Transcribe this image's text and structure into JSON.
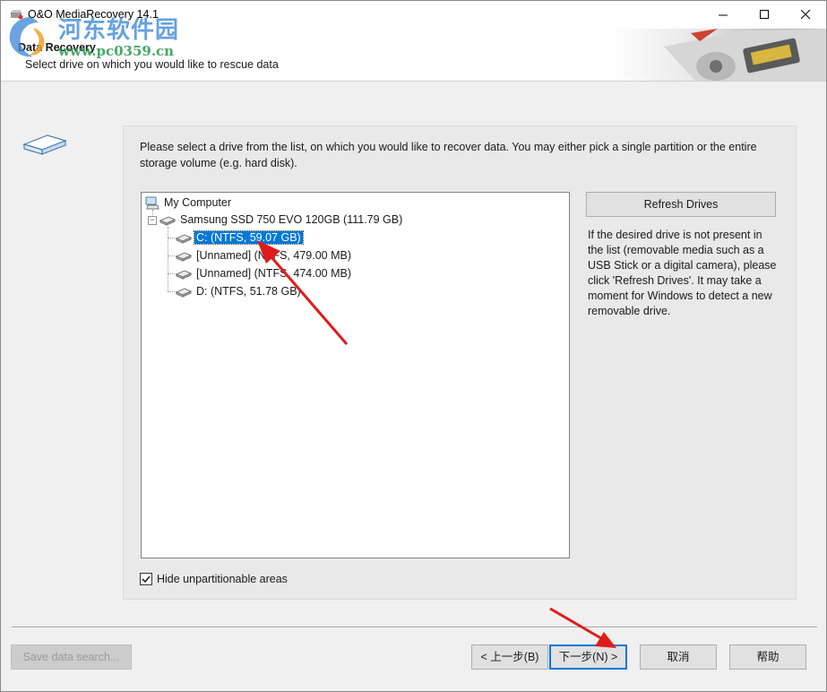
{
  "window": {
    "title": "O&O MediaRecovery 14.1"
  },
  "watermark": {
    "site_name": "河东软件园",
    "url": "www.pc0359.cn"
  },
  "header": {
    "title": "Data Recovery",
    "subtitle": "Select drive on which you would like to rescue data"
  },
  "panel": {
    "instructions": "Please select a drive from the list, on which you would like to recover data. You may either pick a single partition or the entire storage volume (e.g. hard disk).",
    "tree": {
      "root": "My Computer",
      "disk": "Samsung SSD 750 EVO 120GB (111.79 GB)",
      "partitions": [
        {
          "label": "C: (NTFS, 59.07 GB)",
          "selected": true
        },
        {
          "label": "[Unnamed] (NTFS, 479.00 MB)",
          "selected": false
        },
        {
          "label": "[Unnamed] (NTFS, 474.00 MB)",
          "selected": false
        },
        {
          "label": "D: (NTFS, 51.78 GB)",
          "selected": false
        }
      ]
    },
    "refresh_label": "Refresh Drives",
    "help_text": "If the desired drive is not present in the list (removable media such as a USB Stick or a digital camera), please click 'Refresh Drives'. It may take a moment for Windows to detect a new removable drive.",
    "hide_unpartitionable": {
      "label": "Hide unpartitionable areas",
      "checked": true
    }
  },
  "buttons": {
    "save_search": "Save data search...",
    "back": "< 上一步(B)",
    "next": "下一步(N) >",
    "cancel": "取消",
    "help": "帮助"
  },
  "colors": {
    "selection": "#0078d7",
    "annotation_arrow": "#e01b1b"
  }
}
